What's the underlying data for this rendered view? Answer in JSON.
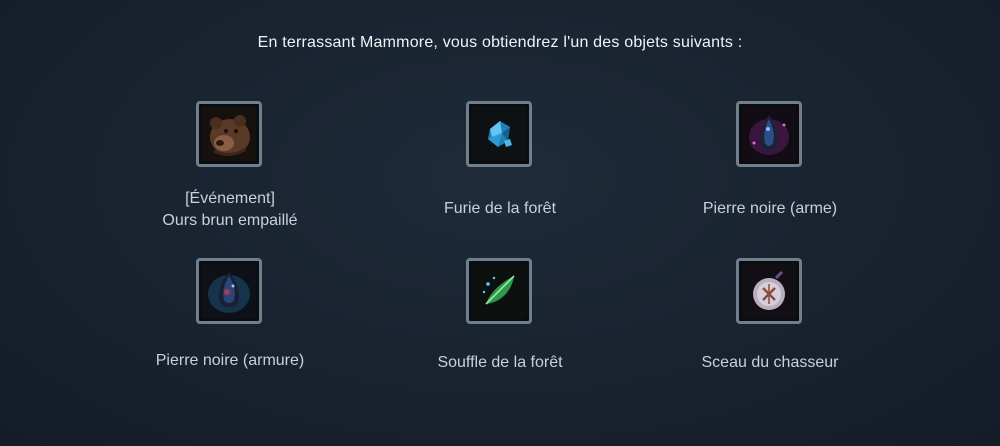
{
  "heading": "En terrassant Mammore, vous obtiendrez l'un des objets suivants :",
  "rewards": [
    {
      "icon": "stuffed-bear-icon",
      "line1": "[Événement]",
      "line2": "Ours brun empaillé"
    },
    {
      "icon": "blue-crystal-icon",
      "line1": "Furie de la forêt"
    },
    {
      "icon": "black-stone-weapon-icon",
      "line1": "Pierre noire (arme)"
    },
    {
      "icon": "black-stone-armor-icon",
      "line1": "Pierre noire (armure)"
    },
    {
      "icon": "green-leaf-icon",
      "line1": "Souffle de la forêt"
    },
    {
      "icon": "hunter-seal-icon",
      "line1": "Sceau du chasseur"
    }
  ],
  "colors": {
    "background": "#1a2431",
    "slot_border": "#6f7f8d",
    "text": "#c9d0da"
  }
}
